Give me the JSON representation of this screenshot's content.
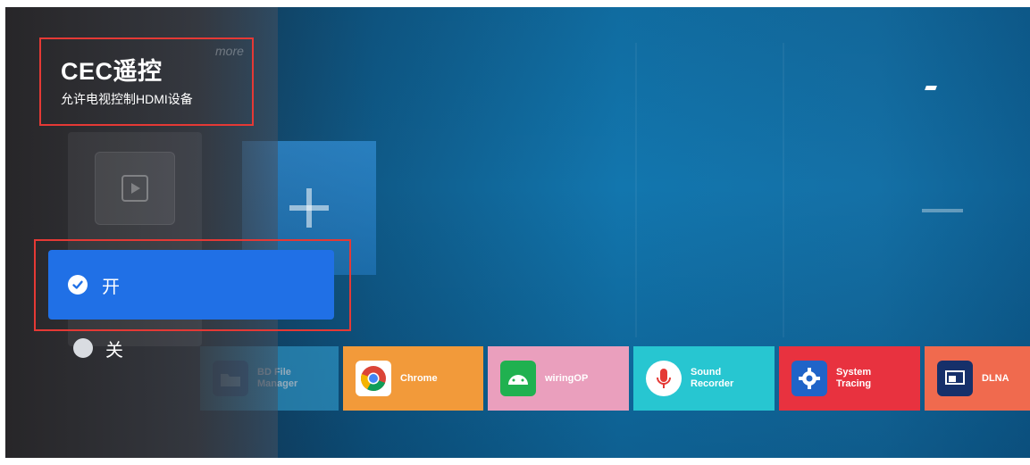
{
  "panel": {
    "title": "CEC遥控",
    "subtitle": "允许电视控制HDMI设备",
    "ghost_text": "more"
  },
  "options": [
    {
      "label": "开",
      "selected": true
    },
    {
      "label": "关",
      "selected": false
    }
  ],
  "apps": [
    {
      "name": "BD File Manager",
      "line1": "BD File",
      "line2": "Manager",
      "color": "#36a6d8",
      "icon": "folder-icon"
    },
    {
      "name": "Chrome",
      "line1": "Chrome",
      "line2": "",
      "color": "#f29a3a",
      "icon": "chrome-icon"
    },
    {
      "name": "wiringOP",
      "line1": "wiringOP",
      "line2": "",
      "color": "#ea9fbd",
      "icon": "android-icon"
    },
    {
      "name": "Sound Recorder",
      "line1": "Sound",
      "line2": "Recorder",
      "color": "#27c6d1",
      "icon": "microphone-icon"
    },
    {
      "name": "System Tracing",
      "line1": "System",
      "line2": "Tracing",
      "color": "#e8323f",
      "icon": "gear-icon"
    },
    {
      "name": "DLNA",
      "line1": "DLNA",
      "line2": "",
      "color": "#f06a4e",
      "icon": "cast-icon"
    }
  ],
  "colors": {
    "selected_option": "#2070e6",
    "highlight_border": "#e53935"
  }
}
